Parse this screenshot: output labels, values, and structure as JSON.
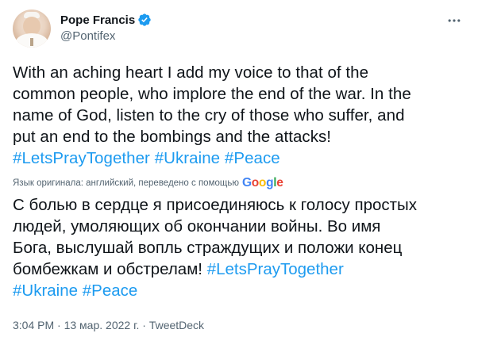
{
  "author": {
    "display_name": "Pope Francis",
    "handle": "@Pontifex",
    "verified_icon": "verified-badge-icon",
    "avatar_icon": "avatar"
  },
  "tweet": {
    "lines": [
      "With an aching heart I add my voice to that of the",
      "common people, who implore the end of the war. In the",
      "name of God, listen to the cry of those who suffer, and",
      "put an end to the bombings and the attacks!"
    ],
    "hashtags": [
      "#LetsPrayTogether",
      "#Ukraine",
      "#Peace"
    ]
  },
  "translation": {
    "note": "Язык оригинала: английский, переведено с помощью",
    "provider": "Google",
    "lines": [
      "С болью в сердце я присоединяюсь к голосу простых",
      "людей, умоляющих об окончании войны. Во имя",
      "Бога, выслушай вопль страждущих и положи конец"
    ],
    "line4_text": "бомбежкам и обстрелам!",
    "line4_tag": "#LetsPrayTogether",
    "line5_tags": [
      "#Ukraine",
      "#Peace"
    ]
  },
  "meta": {
    "time": "3:04 PM",
    "separator": " · ",
    "date": "13 мар. 2022 г.",
    "source": "TweetDeck"
  },
  "colors": {
    "link": "#1d9bf0",
    "text": "#0f1419",
    "secondary": "#536471",
    "google_blue": "#4285f4",
    "google_red": "#ea4335",
    "google_yellow": "#fbbc05",
    "google_green": "#34a853"
  }
}
